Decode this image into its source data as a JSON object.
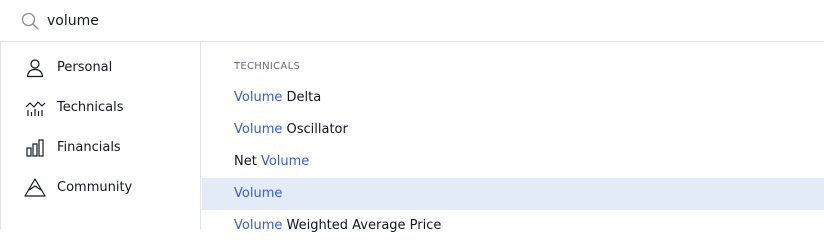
{
  "search": {
    "value": "volume",
    "icon": "search-icon"
  },
  "sidebar": {
    "items": [
      {
        "label": "Personal",
        "icon": "person-icon"
      },
      {
        "label": "Technicals",
        "icon": "technicals-chart-icon"
      },
      {
        "label": "Financials",
        "icon": "bar-chart-icon"
      },
      {
        "label": "Community",
        "icon": "community-icon"
      }
    ]
  },
  "results": {
    "section_title": "TECHNICALS",
    "items": [
      {
        "pre": "",
        "match": "Volume",
        "post": " Delta"
      },
      {
        "pre": "",
        "match": "Volume",
        "post": " Oscillator"
      },
      {
        "pre": "Net ",
        "match": "Volume",
        "post": ""
      },
      {
        "pre": "",
        "match": "Volume",
        "post": "",
        "selected": true
      },
      {
        "pre": "",
        "match": "Volume",
        "post": " Weighted Average Price"
      }
    ]
  },
  "colors": {
    "highlight": "#3b5bd9",
    "selected_row": "#e3ebf8",
    "border": "#e0e3eb"
  }
}
